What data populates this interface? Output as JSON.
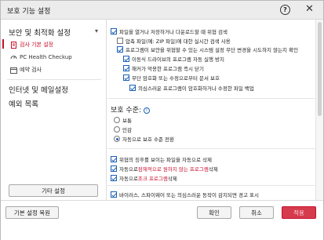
{
  "window": {
    "title": "보호 기능 설정",
    "help_glyph": "?",
    "close_glyph": "✕"
  },
  "sidebar": {
    "section1": "보안 및 최적화 설정",
    "items": [
      {
        "label": "검사 기본 설정",
        "active": true
      },
      {
        "label": "PC Health Checkup"
      },
      {
        "label": "예약 검사"
      }
    ],
    "section2": "인터넷 및 메일설정",
    "section3": "예외 목록",
    "caret": "▾",
    "other_settings_button": "기타 설정"
  },
  "content": {
    "options": [
      {
        "label": "파일을 열거나 저장하거나 다운로드할 때 위협 검색",
        "checked": true
      },
      {
        "label": "압축 파일(예: ZIP 파일)에 대한 실시간 검색 사용",
        "checked": false
      },
      {
        "label": "프로그램이 보안을 위협할 수 있는 시스템 설정 무단 변경을 시도하지 않는지 확인",
        "checked": true
      },
      {
        "label": "이동식 드라이브의 프로그램 자동 실행 방지",
        "checked": true
      },
      {
        "label": "해커가 악용한 프로그램 즉시 닫기",
        "checked": true
      },
      {
        "label": "무단 암호화 또는 수정으로부터 문서 보호",
        "checked": true
      },
      {
        "label": "의심스러운 프로그램이 암호화하거나 수정한 파일 백업",
        "checked": true
      }
    ],
    "protection_level": {
      "title": "보호 수준:",
      "info_glyph": "i",
      "options": [
        {
          "label": "보통",
          "selected": false
        },
        {
          "label": "민감",
          "selected": false
        },
        {
          "label": "자동으로 보호 수준 전환",
          "selected": true
        }
      ]
    },
    "auto_options": [
      {
        "prefix": "위협의 징후를 보이는 파일을 자동으로 삭제",
        "highlight": "",
        "suffix": "",
        "checked": true
      },
      {
        "prefix": "자동으로 ",
        "highlight": "잠재적으로 원하지 않는 프로그램",
        "suffix": " 삭제",
        "checked": true
      },
      {
        "prefix": "자동으로 ",
        "highlight": "조크 프로그램",
        "suffix": " 삭제",
        "checked": true
      }
    ],
    "alert_option": {
      "label": "바이러스, 스파이웨어 또는 의심스러운 동작이 감지되면 경고 표시",
      "checked": true
    }
  },
  "footer": {
    "reset_button": "기본 설정 복원",
    "ok_button": "확인",
    "cancel_button": "취소",
    "apply_button": "적용"
  },
  "colors": {
    "accent_red": "#c8102e",
    "check_blue": "#1a5fb4"
  }
}
